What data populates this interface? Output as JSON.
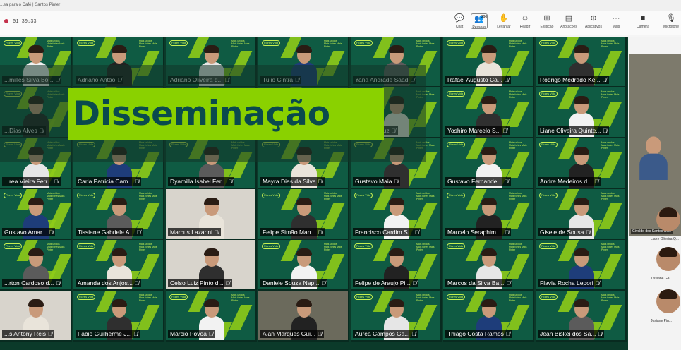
{
  "window": {
    "title": "...sa para o Café | Santos Pinter"
  },
  "meeting": {
    "timer": "01:30:33"
  },
  "toolbar": [
    {
      "label": "Chat",
      "icon": "chat-icon",
      "glyph": "💬"
    },
    {
      "label": "Pessoas",
      "icon": "people-icon",
      "glyph": "👥",
      "badge": "290"
    },
    {
      "label": "Levantar",
      "icon": "raise-hand-icon",
      "glyph": "✋"
    },
    {
      "label": "Reagir",
      "icon": "react-icon",
      "glyph": "☺"
    },
    {
      "label": "Exibição",
      "icon": "view-icon",
      "glyph": "⊞"
    },
    {
      "label": "Anotações",
      "icon": "notes-icon",
      "glyph": "▤"
    },
    {
      "label": "Aplicativos",
      "icon": "apps-icon",
      "glyph": "⊕"
    },
    {
      "label": "Mais",
      "icon": "more-icon",
      "glyph": "⋯"
    },
    {
      "label": "Câmera",
      "icon": "camera-icon",
      "glyph": "■"
    },
    {
      "label": "Microfone",
      "icon": "microphone-icon",
      "glyph": "🎙"
    }
  ],
  "overlay": {
    "title": "Disseminação"
  },
  "brand": {
    "logo": "Flores Vida",
    "tagline": "Mais unidos Mais fortes Mais Pinter"
  },
  "colors": {
    "accent": "#8ad100",
    "brand_green": "#0f5b43",
    "title_text": "#0a4a4d"
  },
  "participants": [
    [
      {
        "name": "...milles Silva Bo..."
      },
      {
        "name": "Adriano Antão"
      },
      {
        "name": "Adriano Oliveira d..."
      },
      {
        "name": "Tulio Cintra"
      },
      {
        "name": "Yana Andrade Saad"
      },
      {
        "name": "Rafael Augusto Ca..."
      },
      {
        "name": "Rodrigo Medrado Ke..."
      }
    ],
    [
      {
        "name": "...Dias Alves"
      },
      {
        "name": ""
      },
      {
        "name": ""
      },
      {
        "name": ""
      },
      {
        "name": "...de da Cruz"
      },
      {
        "name": "Yoshiro Marcelo S..."
      },
      {
        "name": "Liane Oliveira Quinte..."
      }
    ],
    [
      {
        "name": "...rea Vieira Ferr..."
      },
      {
        "name": "Carla Patricia Cam..."
      },
      {
        "name": "Dyamilla Isabel Fer..."
      },
      {
        "name": "Mayra Dias da Silva"
      },
      {
        "name": "Gustavo Maia"
      },
      {
        "name": "Gustavo Fernande..."
      },
      {
        "name": "Andre Medeiros d..."
      }
    ],
    [
      {
        "name": "Gustavo Amar..."
      },
      {
        "name": "Tissiane Gabriele A..."
      },
      {
        "name": "Marcus Lazarini"
      },
      {
        "name": "Felipe Simão Man..."
      },
      {
        "name": "Francisco Cardim S..."
      },
      {
        "name": "Marcelo Seraphim ..."
      },
      {
        "name": "Gisele de Sousa"
      }
    ],
    [
      {
        "name": "...rton Cardoso d..."
      },
      {
        "name": "Amanda dos Anjos..."
      },
      {
        "name": "Celso Luiz Pinto d..."
      },
      {
        "name": "Daniele Souza Nap..."
      },
      {
        "name": "Felipe de Araujo Pi..."
      },
      {
        "name": "Marcos da Silva Ba..."
      },
      {
        "name": "Flavia Rocha Lepori"
      }
    ],
    [
      {
        "name": "...s Antony Reis"
      },
      {
        "name": "Fábio Guilherme J..."
      },
      {
        "name": "Márcio Póvoa"
      },
      {
        "name": "Alan Marques Gui..."
      },
      {
        "name": "Aurea Campos Ga..."
      },
      {
        "name": "Thiago Costa Ramos"
      },
      {
        "name": "Jean Biskei dos Sa..."
      }
    ]
  ],
  "side_panel": {
    "featured": "Givaldo dos Santos Reis",
    "people": [
      {
        "name": "Liane Oliveira Q..."
      },
      {
        "name": "Tissiane Ga..."
      },
      {
        "name": "Josiane Pin..."
      }
    ]
  }
}
